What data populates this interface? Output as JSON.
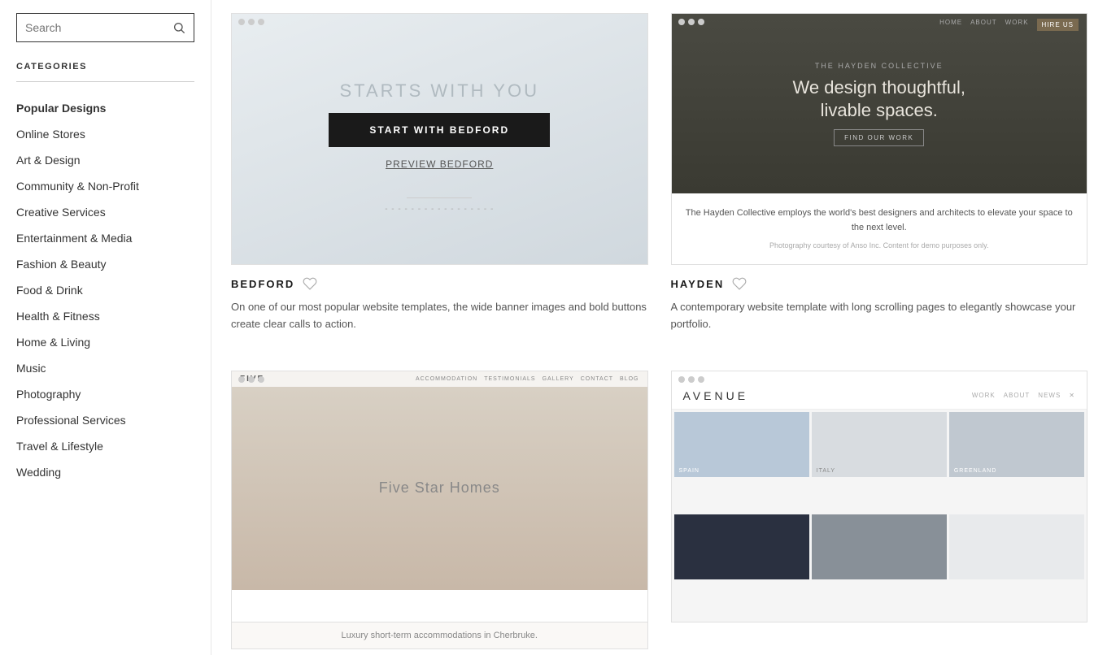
{
  "sidebar": {
    "search_placeholder": "Search",
    "categories_label": "CATEGORIES",
    "items": [
      {
        "id": "popular-designs",
        "label": "Popular Designs",
        "bold": true
      },
      {
        "id": "online-stores",
        "label": "Online Stores",
        "bold": false
      },
      {
        "id": "art-design",
        "label": "Art & Design",
        "bold": false
      },
      {
        "id": "community-nonprofit",
        "label": "Community & Non-Profit",
        "bold": false
      },
      {
        "id": "creative-services",
        "label": "Creative Services",
        "bold": false
      },
      {
        "id": "entertainment-media",
        "label": "Entertainment & Media",
        "bold": false
      },
      {
        "id": "fashion-beauty",
        "label": "Fashion & Beauty",
        "bold": false
      },
      {
        "id": "food-drink",
        "label": "Food & Drink",
        "bold": false
      },
      {
        "id": "health-fitness",
        "label": "Health & Fitness",
        "bold": false
      },
      {
        "id": "home-living",
        "label": "Home & Living",
        "bold": false
      },
      {
        "id": "music",
        "label": "Music",
        "bold": false
      },
      {
        "id": "photography",
        "label": "Photography",
        "bold": false
      },
      {
        "id": "professional-services",
        "label": "Professional Services",
        "bold": false
      },
      {
        "id": "travel-lifestyle",
        "label": "Travel & Lifestyle",
        "bold": false
      },
      {
        "id": "wedding",
        "label": "Wedding",
        "bold": false
      }
    ]
  },
  "templates": [
    {
      "id": "bedford",
      "title": "BEDFORD",
      "description": "On one of our most popular website templates, the wide banner images and bold buttons create clear calls to action.",
      "preview_text": "STARTS WITH YOU",
      "cta_label": "START WITH BEDFORD",
      "preview_link": "PREVIEW BEDFORD",
      "hayden_subtitle": "THE HAYDEN COLLECTIVE",
      "hayden_headline": "We design thoughtful,\nlivable spaces.",
      "hayden_cta": "FIND OUR WORK"
    },
    {
      "id": "hayden",
      "title": "HAYDEN",
      "description": "A contemporary website template with long scrolling pages to elegantly showcase your portfolio.",
      "hayden_body": "The Hayden Collective employs the world's best designers and architects to elevate your space to the next level.",
      "hayden_photo_credit": "Photography courtesy of Anso Inc. Content for demo purposes only."
    },
    {
      "id": "five",
      "title": "FIVE",
      "preview_text": "Five Star Homes",
      "bottom_text": "Luxury short-term accommodations in Cherbruke."
    },
    {
      "id": "avenue",
      "title": "AVENUE",
      "avenue_logo": "AVENUE"
    }
  ]
}
